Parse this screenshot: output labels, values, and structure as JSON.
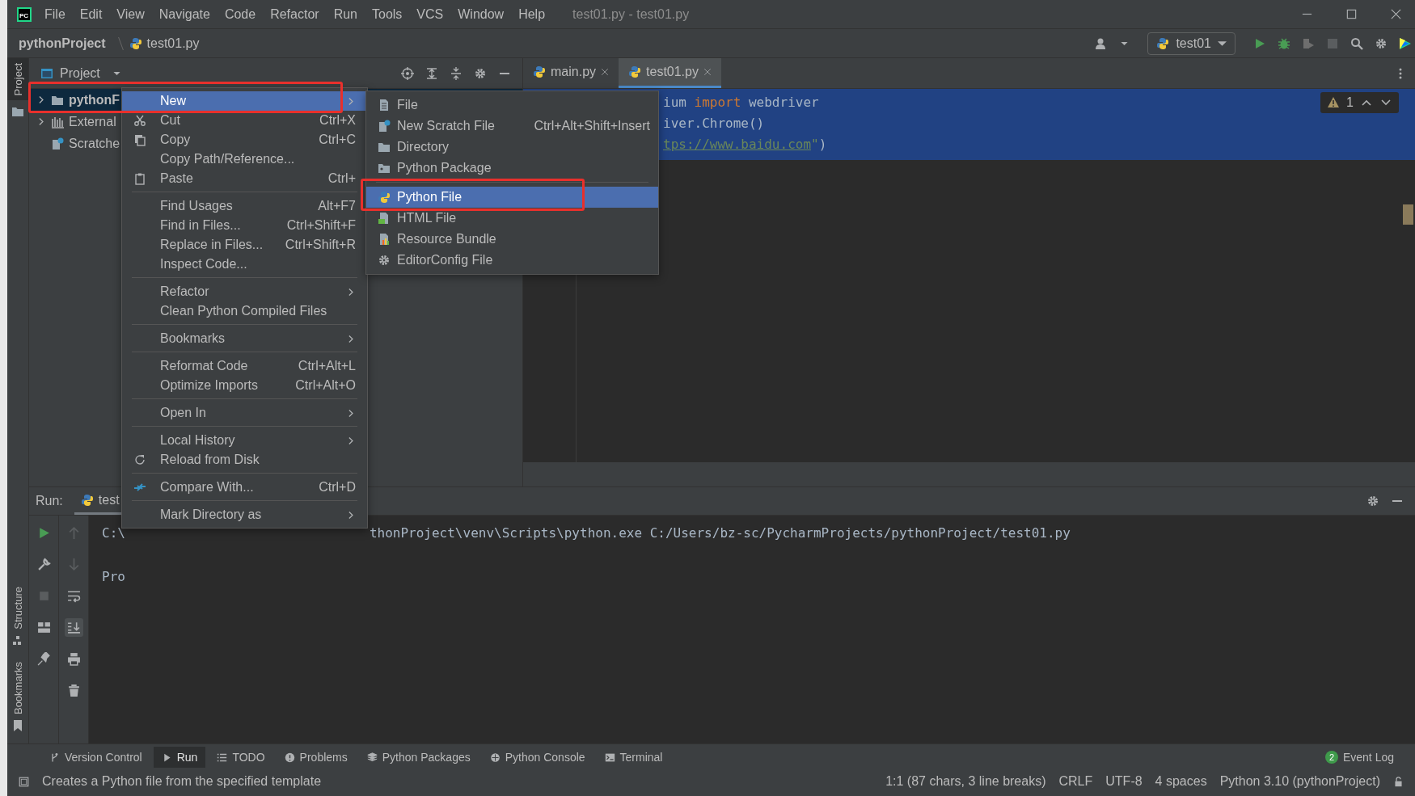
{
  "title_bar": {
    "logo": "PC",
    "menus": [
      "File",
      "Edit",
      "View",
      "Navigate",
      "Code",
      "Refactor",
      "Run",
      "Tools",
      "VCS",
      "Window",
      "Help"
    ],
    "title": "test01.py - test01.py"
  },
  "nav_bar": {
    "breadcrumb": [
      "pythonProject",
      "test01.py"
    ],
    "run_config": "test01"
  },
  "side_stripe": {
    "top": [
      "Project"
    ],
    "bottom": [
      "Structure",
      "Bookmarks"
    ]
  },
  "project_panel": {
    "title": "Project",
    "tree": [
      {
        "label": "pythonF",
        "expanded": false,
        "selected": true
      },
      {
        "label": "External",
        "expanded": false,
        "selected": false
      },
      {
        "label": "Scratche",
        "selected": false
      }
    ]
  },
  "editor": {
    "tabs": [
      {
        "label": "main.py",
        "selected": false
      },
      {
        "label": "test01.py",
        "selected": true
      }
    ],
    "lines": [
      [
        {
          "kind": "plain",
          "text": "ium "
        },
        {
          "kind": "keyword",
          "text": "import"
        },
        {
          "kind": "plain",
          "text": " webdriver"
        }
      ],
      [
        {
          "kind": "plain",
          "text": "iver.Chrome()"
        }
      ],
      [
        {
          "kind": "link",
          "text": "tps://www.baidu.com"
        },
        {
          "kind": "string",
          "text": "\""
        },
        {
          "kind": "plain",
          "text": ")"
        }
      ]
    ],
    "warnings": "1"
  },
  "run_panel": {
    "label": "Run:",
    "tab": "test",
    "console": [
      [
        "C:\\",
        "thonProject\\venv\\Scripts\\python.exe C:/Users/bz-sc/PycharmProjects/pythonProject/test01.py"
      ],
      [
        "Pro"
      ]
    ]
  },
  "context_menu": {
    "groups": [
      [
        {
          "label": "New",
          "selected": true,
          "annotated": true,
          "submenu": true
        },
        {
          "label": "Cut",
          "shortcut": "Ctrl+X",
          "selected": false
        },
        {
          "label": "Copy",
          "shortcut": "Ctrl+C",
          "selected": false
        },
        {
          "label": "Copy Path/Reference...",
          "selected": false
        },
        {
          "label": "Paste",
          "shortcut": "Ctrl+",
          "selected": false
        }
      ],
      [
        {
          "label": "Find Usages",
          "shortcut": "Alt+F7",
          "selected": false
        },
        {
          "label": "Find in Files...",
          "shortcut": "Ctrl+Shift+F",
          "selected": false
        },
        {
          "label": "Replace in Files...",
          "shortcut": "Ctrl+Shift+R",
          "selected": false
        },
        {
          "label": "Inspect Code...",
          "selected": false
        }
      ],
      [
        {
          "label": "Refactor",
          "submenu": true,
          "selected": false
        },
        {
          "label": "Clean Python Compiled Files",
          "selected": false
        }
      ],
      [
        {
          "label": "Bookmarks",
          "submenu": true,
          "selected": false
        }
      ],
      [
        {
          "label": "Reformat Code",
          "shortcut": "Ctrl+Alt+L",
          "selected": false
        },
        {
          "label": "Optimize Imports",
          "shortcut": "Ctrl+Alt+O",
          "selected": false
        }
      ],
      [
        {
          "label": "Open In",
          "submenu": true,
          "selected": false
        }
      ],
      [
        {
          "label": "Local History",
          "submenu": true,
          "selected": false
        },
        {
          "label": "Reload from Disk",
          "selected": false
        }
      ],
      [
        {
          "label": "Compare With...",
          "shortcut": "Ctrl+D",
          "selected": false
        }
      ],
      [
        {
          "label": "Mark Directory as",
          "submenu": true,
          "selected": false
        }
      ]
    ]
  },
  "new_submenu": {
    "groups": [
      [
        {
          "label": "File",
          "selected": false
        },
        {
          "label": "New Scratch File",
          "shortcut": "Ctrl+Alt+Shift+Insert",
          "selected": false
        },
        {
          "label": "Directory",
          "selected": false
        },
        {
          "label": "Python Package",
          "selected": false
        }
      ],
      [
        {
          "label": "Python File",
          "selected": true,
          "annotated": true
        },
        {
          "label": "HTML File",
          "selected": false
        },
        {
          "label": "Resource Bundle",
          "selected": false
        },
        {
          "label": "EditorConfig File",
          "selected": false
        }
      ]
    ]
  },
  "tool_windows": [
    {
      "label": "Version Control",
      "selected": false
    },
    {
      "label": "Run",
      "selected": true
    },
    {
      "label": "TODO",
      "selected": false
    },
    {
      "label": "Problems",
      "selected": false
    },
    {
      "label": "Python Packages",
      "selected": false
    },
    {
      "label": "Python Console",
      "selected": false
    },
    {
      "label": "Terminal",
      "selected": false
    }
  ],
  "event_log": {
    "count": "2",
    "label": "Event Log"
  },
  "status_bar": {
    "message": "Creates a Python file from the specified template",
    "items": [
      "1:1 (87 chars, 3 line breaks)",
      "CRLF",
      "UTF-8",
      "4 spaces",
      "Python 3.10 (pythonProject)"
    ]
  }
}
